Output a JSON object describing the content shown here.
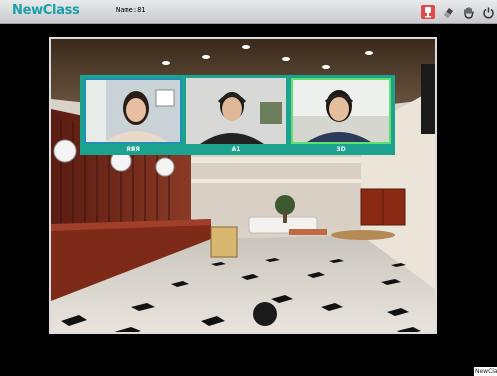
{
  "app": {
    "logo_text": "NewClass",
    "name_label": "Name:81"
  },
  "toolbar": {
    "buttons": [
      {
        "icon": "record-icon"
      },
      {
        "icon": "eraser-icon"
      },
      {
        "icon": "hand-icon"
      },
      {
        "icon": "power-icon"
      }
    ]
  },
  "students": [
    {
      "label": "ЯЯЯ"
    },
    {
      "label": "A1"
    },
    {
      "label": "3D"
    }
  ],
  "watermark": "NewCla",
  "colors": {
    "accent": "#19a0a8",
    "tile_bar": "#1ca38f",
    "active_border": "#5fe06f"
  }
}
